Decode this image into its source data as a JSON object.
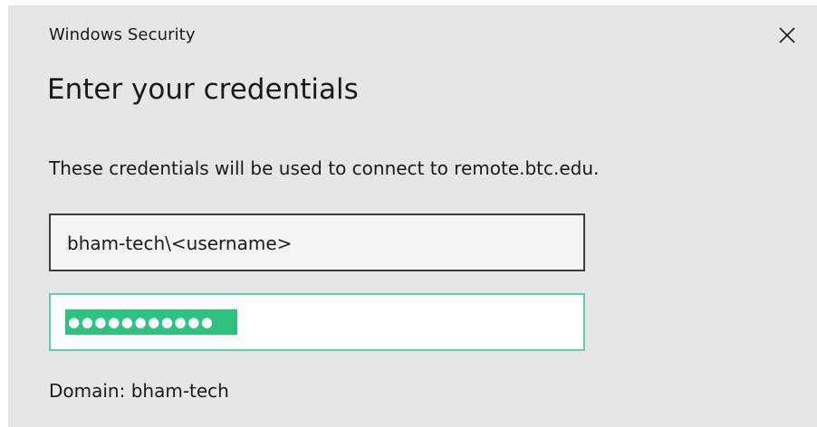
{
  "window": {
    "title": "Windows Security",
    "close_icon": "close-icon"
  },
  "dialog": {
    "heading": "Enter your credentials",
    "message": "These credentials will be used to connect to remote.btc.edu.",
    "username_value": "bham-tech\\<username>",
    "password_mask": "●●●●●●●●●●●",
    "password_selected": true,
    "domain_text": "Domain: bham-tech"
  },
  "colors": {
    "dialog_background": "#e6e6e6",
    "focus_border": "#5fd1a2",
    "selection": "#2ec27e"
  }
}
